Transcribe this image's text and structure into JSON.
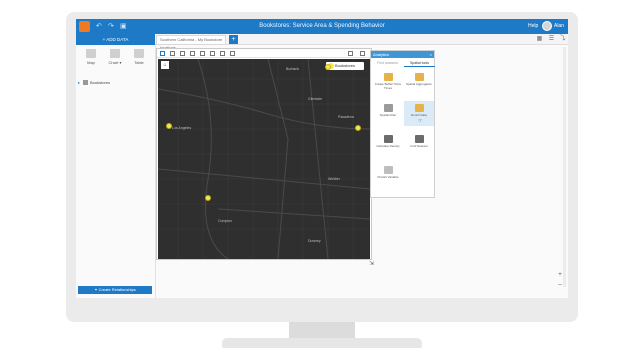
{
  "window": {
    "title": "Bookstores: Service Area & Spending Behavior",
    "user_menu_label": "Help",
    "user_name": "Alan"
  },
  "toolbar": {
    "add_data_label": "+ ADD DATA",
    "page_tab_label": "Southern California - My Bookstore locations",
    "add_page_label": "+"
  },
  "left_panel": {
    "tools": [
      {
        "label": "Map",
        "icon": "map-icon"
      },
      {
        "label": "Chart ▾",
        "icon": "chart-icon"
      },
      {
        "label": "Table",
        "icon": "table-icon"
      }
    ],
    "datasets": [
      {
        "label": "Bookstores",
        "icon": "dataset-icon"
      }
    ],
    "create_relationships_label": "Create Relationships"
  },
  "map": {
    "legend_label": "Bookstores",
    "labels": [
      "Burbank",
      "Glendale",
      "Pasadena",
      "Los Angeles",
      "Whittier",
      "Downey",
      "Compton"
    ]
  },
  "analytics": {
    "title": "Analytics",
    "close_label": "×",
    "tabs": [
      {
        "label": "Find answers",
        "active": false
      },
      {
        "label": "Spatial tools",
        "active": true
      }
    ],
    "tools": [
      {
        "label": "Create Buffer/ Drive Times",
        "icon": "buffer-icon",
        "color": "#e6b34a"
      },
      {
        "label": "Spatial Aggregation",
        "icon": "aggregation-icon",
        "color": "#e6b34a"
      },
      {
        "label": "Spatial Filter",
        "icon": "filter-icon",
        "color": "#9a9a9a"
      },
      {
        "label": "Enrich Data",
        "icon": "enrich-icon",
        "color": "#e6b34a"
      },
      {
        "label": "Calculate Density",
        "icon": "density-icon",
        "color": "#6b6b6b"
      },
      {
        "label": "Find Nearest",
        "icon": "nearest-icon",
        "color": "#6b6b6b"
      },
      {
        "label": "Predict Variable",
        "icon": "predict-icon",
        "color": "#bdbdbd"
      }
    ],
    "hovered_tool": "Enrich Data"
  },
  "colors": {
    "accent": "#1e7ac7",
    "map_bg": "#2f2f2f",
    "poi": "#f3e74a",
    "hover_cell": "#dbeaf7"
  }
}
